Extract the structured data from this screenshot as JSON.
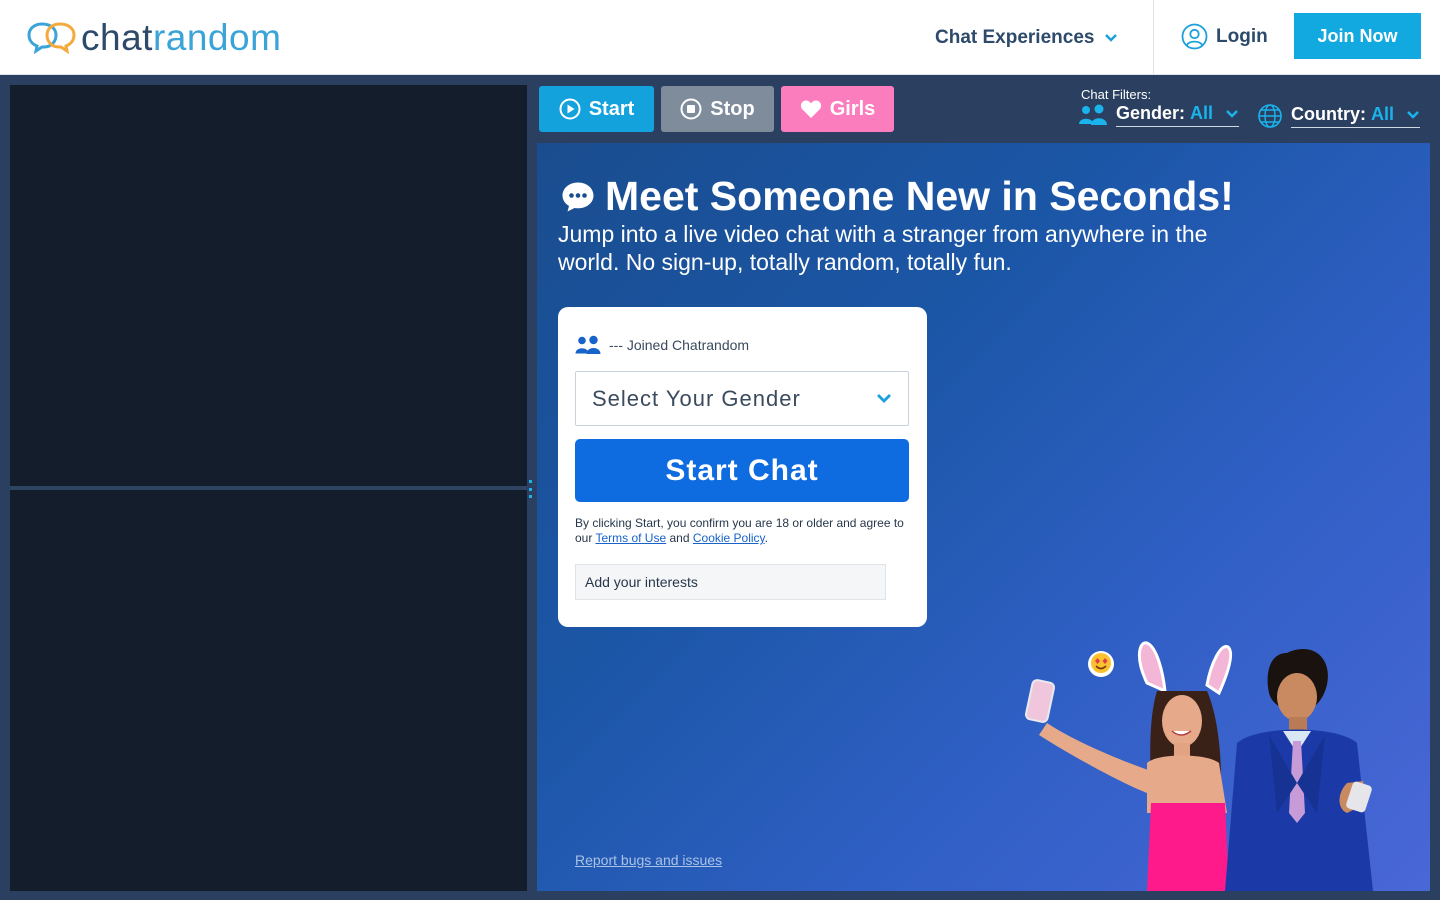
{
  "brand": {
    "part1": "chat",
    "part2": "random",
    "color_dark": "#2d4a6b",
    "color_light": "#3aa4d8"
  },
  "header": {
    "nav_experiences": "Chat Experiences",
    "login": "Login",
    "join": "Join Now",
    "icons": [
      "chat-bubbles-logo-icon",
      "chevron-down-icon",
      "user-circle-icon"
    ]
  },
  "controls": {
    "start": "Start",
    "stop": "Stop",
    "girls": "Girls",
    "colors": {
      "start": "#13a2dc",
      "stop": "#7e8c9b",
      "girls": "#fb7dbd"
    }
  },
  "filters": {
    "label": "Chat Filters:",
    "gender_key": "Gender:",
    "gender_value": "All",
    "country_key": "Country:",
    "country_value": "All"
  },
  "hero": {
    "title": "Meet Someone New in Seconds!",
    "subtitle": "Jump into a live video chat with a stranger from anywhere in the world. No sign-up, totally random, totally fun."
  },
  "card": {
    "joined": "--- Joined Chatrandom",
    "gender_placeholder": "Select Your Gender",
    "start_chat": "Start Chat",
    "legal_prefix": "By clicking Start, you confirm you are 18 or older and agree to our ",
    "terms": "Terms of Use",
    "legal_and": " and ",
    "cookie": "Cookie Policy",
    "legal_suffix": ".",
    "interests_placeholder": "Add your interests"
  },
  "footer": {
    "report": "Report bugs and issues"
  }
}
